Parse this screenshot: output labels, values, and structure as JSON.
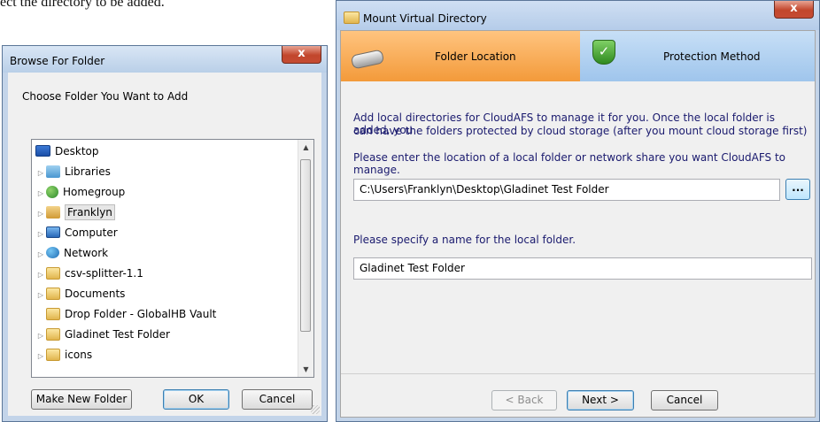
{
  "background_text": "ect the directory to be added.",
  "browse_dialog": {
    "title": "Browse For Folder",
    "close_label": "x",
    "prompt": "Choose Folder You Want to Add",
    "tree_items": [
      {
        "label": "Desktop",
        "icon": "desktop-icon",
        "arrow": ""
      },
      {
        "label": "Libraries",
        "icon": "libraries-icon",
        "arrow": "▷"
      },
      {
        "label": "Homegroup",
        "icon": "homegroup-icon",
        "arrow": "▷"
      },
      {
        "label": "Franklyn",
        "icon": "user-folder-icon",
        "arrow": "▷"
      },
      {
        "label": "Computer",
        "icon": "computer-icon",
        "arrow": "▷"
      },
      {
        "label": "Network",
        "icon": "network-icon",
        "arrow": "▷"
      },
      {
        "label": "csv-splitter-1.1",
        "icon": "folder-icon",
        "arrow": "▷"
      },
      {
        "label": "Documents",
        "icon": "folder-icon",
        "arrow": "▷"
      },
      {
        "label": "Drop Folder - GlobalHB Vault",
        "icon": "folder-icon",
        "arrow": ""
      },
      {
        "label": "Gladinet Test Folder",
        "icon": "folder-icon",
        "arrow": "▷"
      },
      {
        "label": "icons",
        "icon": "folder-icon",
        "arrow": "▷"
      }
    ],
    "selected_item": "Franklyn",
    "buttons": {
      "make_new_folder": "Make New Folder",
      "ok": "OK",
      "cancel": "Cancel"
    }
  },
  "mount_dialog": {
    "title": "Mount Virtual Directory",
    "close_label": "x",
    "steps": [
      {
        "label": "Folder Location",
        "active": true,
        "icon": "disk-icon"
      },
      {
        "label": "Protection Method",
        "active": false,
        "icon": "shield-check-icon"
      }
    ],
    "description_line1": "Add local directories for CloudAFS to manage it for you. Once the local folder is added, you",
    "description_line2": "can have the folders protected by cloud storage (after you mount cloud storage first)",
    "location_prompt": "Please enter the location of a local folder or network share you want CloudAFS to manage.",
    "location_value": "C:\\Users\\Franklyn\\Desktop\\Gladinet Test Folder",
    "browse_button": "...",
    "name_prompt": "Please specify a name for the local folder.",
    "name_value": "Gladinet Test Folder",
    "buttons": {
      "back": "< Back",
      "next": "Next >",
      "cancel": "Cancel"
    }
  },
  "colors": {
    "active_step": "#f39a3a",
    "inactive_step": "#9fc5ec",
    "prompt_text": "#1a1a6e"
  }
}
